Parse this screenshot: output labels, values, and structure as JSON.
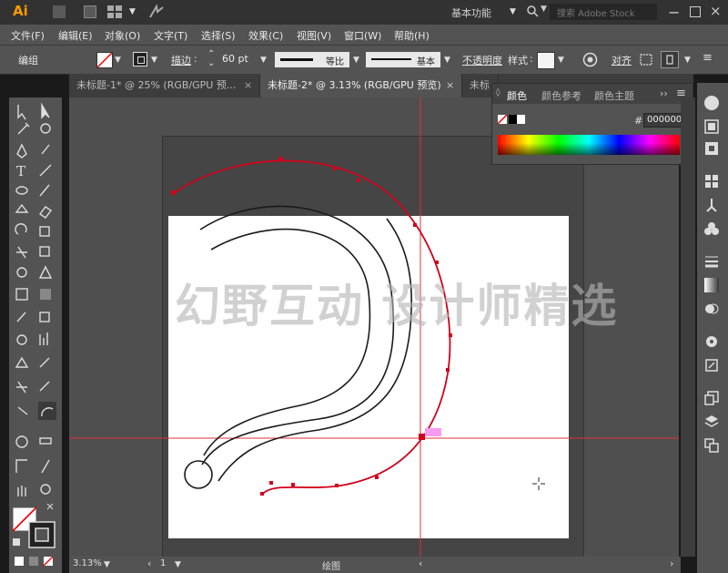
{
  "app": {
    "logo": "Ai",
    "workspace": "基本功能",
    "search_placeholder": "搜索 Adobe Stock"
  },
  "menu": [
    "文件(F)",
    "编辑(E)",
    "对象(O)",
    "文字(T)",
    "选择(S)",
    "效果(C)",
    "视图(V)",
    "窗口(W)",
    "帮助(H)"
  ],
  "control": {
    "selection_label": "编组",
    "stroke_label": "描边",
    "stroke_weight": "60 pt",
    "profile1": "等比",
    "profile2": "基本",
    "opacity_label": "不透明度",
    "style_label": "样式",
    "align_label": "对齐"
  },
  "tabs": [
    {
      "label": "未标题-1* @ 25% (RGB/GPU 预..."
    },
    {
      "label": "未标题-2* @ 3.13% (RGB/GPU 预览)"
    },
    {
      "label": "未标"
    }
  ],
  "panel": {
    "tabs": [
      "颜色",
      "颜色参考",
      "颜色主题"
    ],
    "hex_label": "#",
    "hex_value": "000000"
  },
  "watermark": "幻野互动 设计师精选",
  "status": {
    "zoom": "3.13%",
    "page": "1",
    "mode": "绘图"
  },
  "colors": {
    "accent_path": "#d0021b",
    "guide": "#e0303a",
    "ui_bg": "#535353"
  }
}
